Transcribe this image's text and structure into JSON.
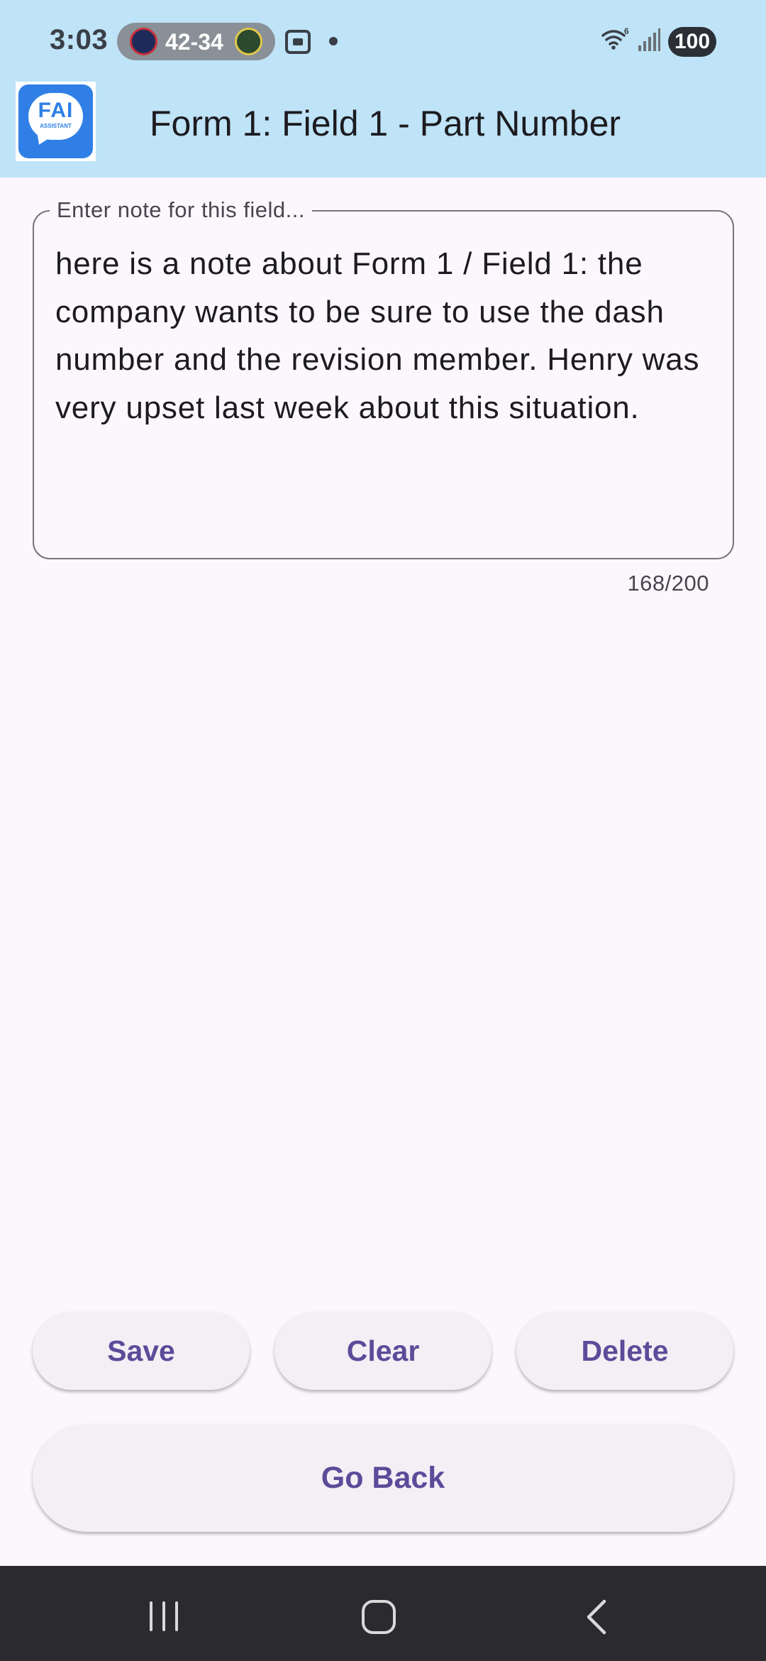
{
  "status_bar": {
    "time": "3:03",
    "score": "42-34",
    "battery": "100",
    "icons": [
      "team-logo",
      "team-logo",
      "screenshot-icon",
      "notification-dot",
      "wifi-6-icon",
      "cellular-signal-icon",
      "battery-icon"
    ]
  },
  "app_bar": {
    "logo_text": "FAI",
    "logo_subtext": "ASSISTANT",
    "title": "Form 1: Field 1 - Part Number"
  },
  "note_field": {
    "label": "Enter note for this field...",
    "value": "here is a note about Form 1 / Field 1: the company wants to be sure to use the dash number and the revision member. Henry was very upset last week about this situation.",
    "counter": "168/200"
  },
  "actions": {
    "save_label": "Save",
    "clear_label": "Clear",
    "delete_label": "Delete",
    "go_back_label": "Go Back"
  },
  "colors": {
    "app_bar_bg": "#bfe3f7",
    "page_bg": "#fbf7fc",
    "button_bg": "#f3eff5",
    "button_text": "#5c4b99",
    "nav_bar_bg": "#2b2a2e",
    "logo_blue": "#2f7fe6"
  }
}
